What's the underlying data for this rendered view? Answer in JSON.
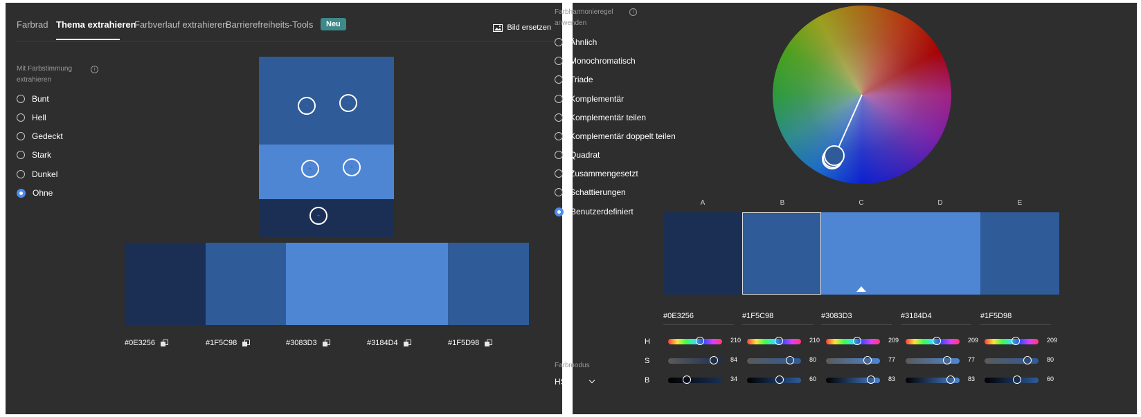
{
  "tabs": [
    {
      "label": "Farbrad"
    },
    {
      "label": "Thema extrahieren"
    },
    {
      "label": "Farbverlauf extrahieren"
    },
    {
      "label": "Barrierefreiheits-Tools"
    }
  ],
  "badge_new": "Neu",
  "replace_image": "Bild ersetzen",
  "mood": {
    "title_line1": "Mit Farbstimmung",
    "title_line2": "extrahieren",
    "options": [
      "Bunt",
      "Hell",
      "Gedeckt",
      "Stark",
      "Dunkel",
      "Ohne"
    ],
    "selected": "Ohne"
  },
  "image_colors": [
    "#2f5b99",
    "#4e86d4",
    "#1b2f55"
  ],
  "palette": [
    {
      "letter": "A",
      "hex": "#0E3256",
      "display": "#1b2f55",
      "hsb": {
        "H": 210,
        "S": 84,
        "B": 34
      }
    },
    {
      "letter": "B",
      "hex": "#1F5C98",
      "display": "#2f5b99",
      "hsb": {
        "H": 210,
        "S": 80,
        "B": 60
      }
    },
    {
      "letter": "C",
      "hex": "#3083D3",
      "display": "#4e86d4",
      "hsb": {
        "H": 209,
        "S": 77,
        "B": 83
      }
    },
    {
      "letter": "D",
      "hex": "#3184D4",
      "display": "#4e86d4",
      "hsb": {
        "H": 209,
        "S": 77,
        "B": 83
      }
    },
    {
      "letter": "E",
      "hex": "#1F5D98",
      "display": "#2f5b99",
      "hsb": {
        "H": 209,
        "S": 80,
        "B": 60
      }
    }
  ],
  "selected_swatch": "B",
  "harmony": {
    "title_line1": "Farbharmonieregel",
    "title_line2": "anwenden",
    "options": [
      "Ähnlich",
      "Monochromatisch",
      "Triade",
      "Komplementär",
      "Komplementär teilen",
      "Komplementär doppelt teilen",
      "Quadrat",
      "Zusammengesetzt",
      "Schattierungen",
      "Benutzerdefiniert"
    ],
    "selected": "Benutzerdefiniert"
  },
  "slider_labels": [
    "H",
    "S",
    "B"
  ],
  "color_mode": {
    "label": "Farbmodus",
    "value": "HSB"
  },
  "icons": {
    "info": "info-icon",
    "image": "image-icon",
    "copy": "copy-icon",
    "chevron": "chevron-down-icon"
  }
}
